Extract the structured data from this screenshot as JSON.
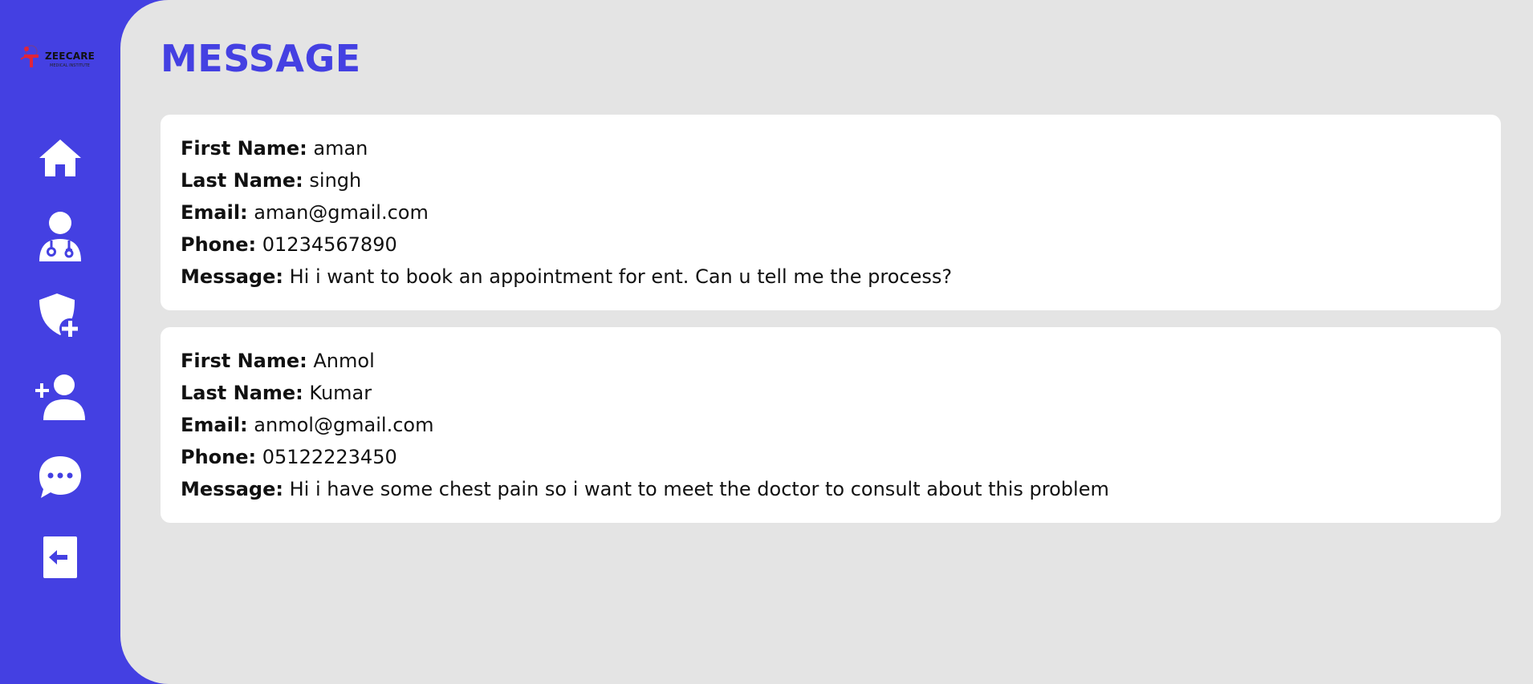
{
  "brand": {
    "name": "ZEECARE",
    "tagline": "MEDICAL INSTITUTE"
  },
  "sidebar": {
    "items": [
      {
        "name": "dashboard",
        "icon": "home-icon"
      },
      {
        "name": "doctors",
        "icon": "doctor-icon"
      },
      {
        "name": "add-admin",
        "icon": "shield-plus-icon"
      },
      {
        "name": "add-doctor",
        "icon": "user-plus-icon"
      },
      {
        "name": "messages",
        "icon": "chat-bubble-icon"
      },
      {
        "name": "logout",
        "icon": "logout-icon"
      }
    ]
  },
  "page": {
    "title": "MESSAGE"
  },
  "labels": {
    "first_name": "First Name:",
    "last_name": "Last Name:",
    "email": "Email:",
    "phone": "Phone:",
    "message": "Message:"
  },
  "messages": [
    {
      "first_name": "aman",
      "last_name": "singh",
      "email": "aman@gmail.com",
      "phone": "01234567890",
      "message": "Hi i want to book an appointment for ent. Can u tell me the process?"
    },
    {
      "first_name": "Anmol",
      "last_name": "Kumar",
      "email": "anmol@gmail.com",
      "phone": "05122223450",
      "message": "Hi i have some chest pain so i want to meet the doctor to consult about this problem"
    }
  ],
  "colors": {
    "accent": "#4440e2",
    "background": "#e4e4e4",
    "card": "#ffffff",
    "logo_red": "#e0243a"
  }
}
